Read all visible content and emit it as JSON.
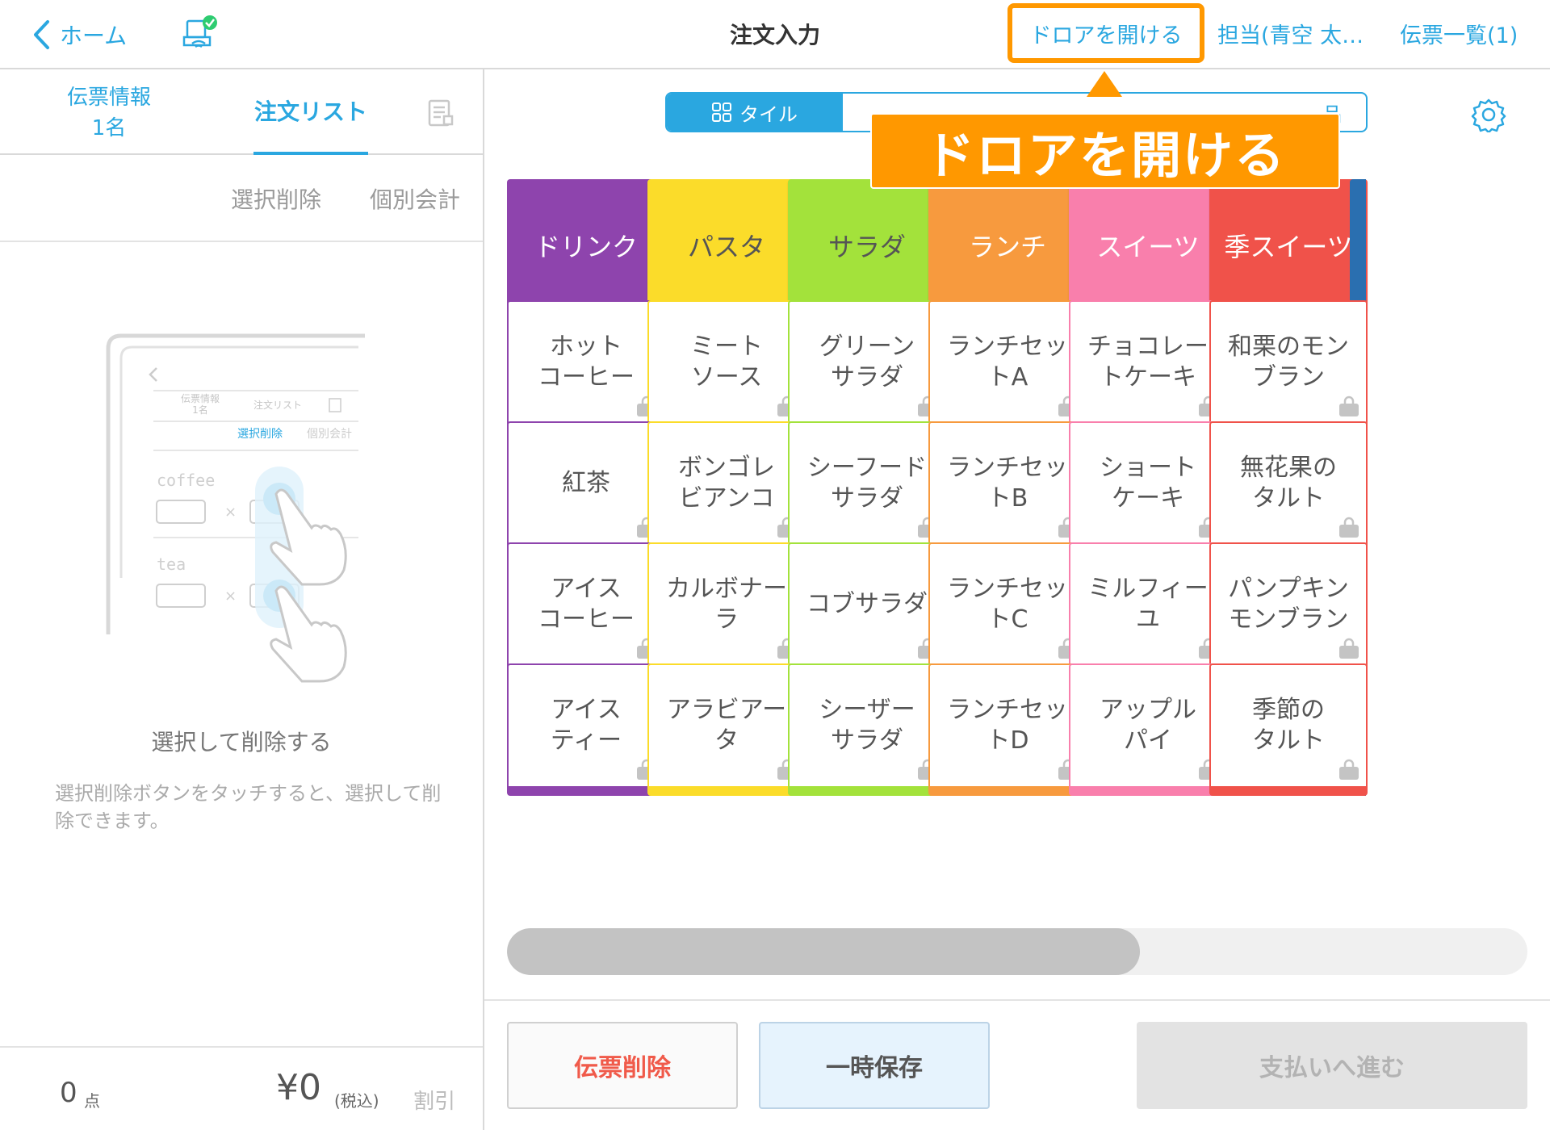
{
  "header": {
    "back_label": "ホーム",
    "title": "注文入力",
    "drawer_label": "ドロアを開ける",
    "staff_label": "担当(青空 太…",
    "slips_label": "伝票一覧(1)"
  },
  "left": {
    "tab_info_line1": "伝票情報",
    "tab_info_line2": "1名",
    "tab_orders": "注文リスト",
    "select_delete": "選択削除",
    "split_bill": "個別会計",
    "illustration": {
      "tab_info": "伝票情報",
      "tab_info_sub": "1名",
      "tab_orders": "注文リスト",
      "select_delete": "選択削除",
      "split_bill": "個別会計",
      "item1": "coffee",
      "item2": "tea"
    },
    "hint_title": "選択して削除する",
    "hint_body": "選択削除ボタンをタッチすると、選択して削除できます。",
    "count_value": "0",
    "count_unit": "点",
    "total_value": "¥0",
    "total_tax": "(税込)",
    "discount": "割引"
  },
  "view_toggle": {
    "tile_label": "タイル",
    "other_label": "品"
  },
  "callout": "ドロアを開ける",
  "categories": [
    {
      "label": "ドリンク",
      "color": "#8e44ad",
      "light": false
    },
    {
      "label": "パスタ",
      "color": "#fbdc2a",
      "light": true
    },
    {
      "label": "サラダ",
      "color": "#a3e23b",
      "light": true
    },
    {
      "label": "ランチ",
      "color": "#f79a3e",
      "light": false
    },
    {
      "label": "スイーツ",
      "color": "#f97fac",
      "light": false
    },
    {
      "label": "季スイーツ",
      "color": "#f0524a",
      "light": false
    }
  ],
  "edge_color": "#2a6fb0",
  "items": [
    [
      "ホット\nコーヒー",
      "ミート\nソース",
      "グリーン\nサラダ",
      "ランチセッ\nトA",
      "チョコレー\nトケーキ",
      "和栗のモン\nブラン"
    ],
    [
      "紅茶",
      "ボンゴレ\nビアンコ",
      "シーフード\nサラダ",
      "ランチセッ\nトB",
      "ショート\nケーキ",
      "無花果の\nタルト"
    ],
    [
      "アイス\nコーヒー",
      "カルボナー\nラ",
      "コブサラダ",
      "ランチセッ\nトC",
      "ミルフィー\nユ",
      "パンプキン\nモンブラン"
    ],
    [
      "アイス\nティー",
      "アラビアー\nタ",
      "シーザー\nサラダ",
      "ランチセッ\nトD",
      "アップル\nパイ",
      "季節の\nタルト"
    ]
  ],
  "scroll_fraction": 0.62,
  "buttons": {
    "delete": "伝票削除",
    "hold": "一時保存",
    "pay": "支払いへ進む"
  }
}
